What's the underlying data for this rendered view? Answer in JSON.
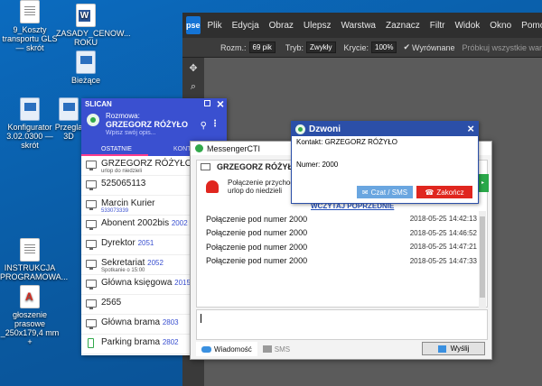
{
  "desktop": {
    "icons": [
      {
        "id": "gls",
        "label": "9_Koszty transportu GLS — skrót",
        "type": "doc"
      },
      {
        "id": "zasady",
        "label": "ZASADY_CENOW... ROKU",
        "type": "word"
      },
      {
        "id": "biezace",
        "label": "Bieżące",
        "type": "app"
      },
      {
        "id": "konfigurator",
        "label": "Konfigurator 3.02.0300 — skrót",
        "type": "app"
      },
      {
        "id": "przeglad",
        "label": "Przegla 3D",
        "type": "app"
      },
      {
        "id": "instrukcja",
        "label": "INSTRUKCJA PROGRAMOWA...",
        "type": "doc"
      },
      {
        "id": "ogloszenie",
        "label": "głoszenie prasowe _250x179,4 mm +",
        "type": "pdf"
      }
    ]
  },
  "photoshop": {
    "logo": "pse",
    "menu": [
      "Plik",
      "Edycja",
      "Obraz",
      "Ulepsz",
      "Warstwa",
      "Zaznacz",
      "Filtr",
      "Widok",
      "Okno",
      "Pomoc"
    ],
    "options": {
      "size_label": "Rozm.:",
      "size_value": "69 pik",
      "mode_label": "Tryb:",
      "mode_value": "Zwykły",
      "opacity_label": "Krycie:",
      "opacity_value": "100%",
      "smooth_label": "Wyrównane",
      "sample_label": "Próbkuj wszystkie warst"
    }
  },
  "dzwoni": {
    "title": "Dzwoni",
    "contact": "Kontakt: GRZEGORZ RÓŻYŁO",
    "number": "Numer: 2000",
    "chat_button": "Czat / SMS",
    "end_button": "Zakończ"
  },
  "rozmowa": {
    "app_name": "SLICAN",
    "label": "Rozmowa:",
    "name": "GRZEGORZ RÓŻYŁO",
    "placeholder": "Wpisz swój opis...",
    "tab_recent": "OSTATNIE",
    "tab_contacts": "KONT",
    "contacts": [
      {
        "name": "GRZEGORZ RÓŻYŁO",
        "ext": "2000",
        "sub": "urlop do niedzieli",
        "icon": "desk"
      },
      {
        "name": "525065113",
        "ext": "",
        "sub": "",
        "icon": "desk"
      },
      {
        "name": "Marcin Kurier",
        "ext": "",
        "sub": "533073339",
        "icon": "desk"
      },
      {
        "name": "Abonent 2002bis",
        "ext": "2002",
        "sub": "",
        "icon": "desk"
      },
      {
        "name": "Dyrektor",
        "ext": "2051",
        "sub": "",
        "icon": "desk"
      },
      {
        "name": "Sekretariat",
        "ext": "2052",
        "sub": "Spotkanie o 15:00",
        "icon": "desk"
      },
      {
        "name": "Główna księgowa",
        "ext": "2015",
        "sub": "",
        "icon": "desk"
      },
      {
        "name": "2565",
        "ext": "",
        "sub": "",
        "icon": "desk"
      },
      {
        "name": "Główna brama",
        "ext": "2803",
        "sub": "",
        "icon": "desk"
      },
      {
        "name": "Parking brama",
        "ext": "2802",
        "sub": "",
        "icon": "mobile"
      }
    ]
  },
  "cti": {
    "title": "MessengerCTI",
    "contact_name": "GRZEGORZ RÓŻYŁO",
    "notify_line1": "Połączenie przychodzące",
    "notify_line2": "urlop do niedzieli",
    "load_previous": "WCZYTAJ POPRZEDNIE",
    "messages": [
      {
        "text": "Połączenie pod numer 2000",
        "time": "2018-05-25 14:42:13"
      },
      {
        "text": "Połączenie pod numer 2000",
        "time": "2018-05-25 14:46:52"
      },
      {
        "text": "Połączenie pod numer 2000",
        "time": "2018-05-25 14:47:21"
      },
      {
        "text": "Połączenie pod numer 2000",
        "time": "2018-05-25 14:47:33"
      }
    ],
    "tab_message": "Wiadomość",
    "tab_sms": "SMS",
    "send_button": "Wyślij"
  }
}
